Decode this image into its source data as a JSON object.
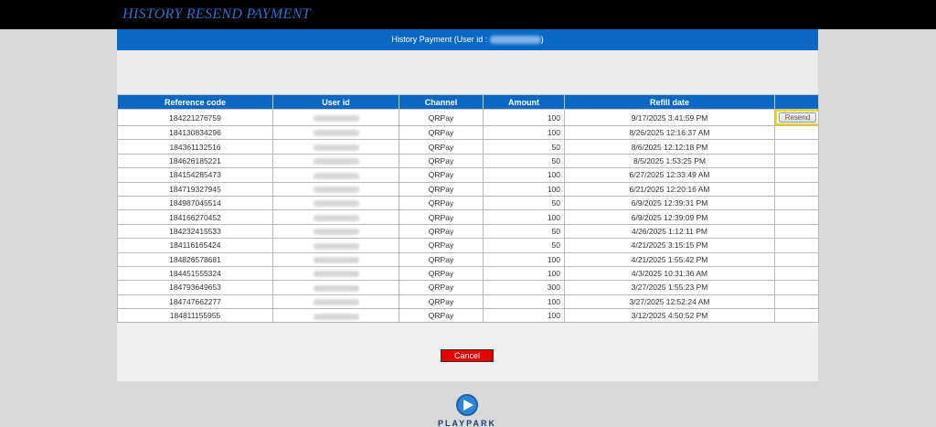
{
  "header": {
    "title": "HISTORY RESEND PAYMENT"
  },
  "panel": {
    "title_prefix": "History Payment (User id :",
    "title_suffix": ")"
  },
  "table": {
    "columns": [
      "Reference code",
      "User id",
      "Channel",
      "Amount",
      "Refill date",
      ""
    ],
    "rows": [
      {
        "ref": "184221276759",
        "channel": "QRPay",
        "amount": "100",
        "date": "9/17/2025 3:41:59 PM"
      },
      {
        "ref": "184130834296",
        "channel": "QRPay",
        "amount": "100",
        "date": "8/26/2025 12:16:37 AM"
      },
      {
        "ref": "184361132516",
        "channel": "QRPay",
        "amount": "50",
        "date": "8/6/2025 12:12:18 PM"
      },
      {
        "ref": "184626185221",
        "channel": "QRPay",
        "amount": "50",
        "date": "8/5/2025 1:53:25 PM"
      },
      {
        "ref": "184154285473",
        "channel": "QRPay",
        "amount": "100",
        "date": "6/27/2025 12:33:49 AM"
      },
      {
        "ref": "184719327945",
        "channel": "QRPay",
        "amount": "100",
        "date": "6/21/2025 12:20:16 AM"
      },
      {
        "ref": "184987045514",
        "channel": "QRPay",
        "amount": "50",
        "date": "6/9/2025 12:39:31 PM"
      },
      {
        "ref": "184166270452",
        "channel": "QRPay",
        "amount": "100",
        "date": "6/9/2025 12:39:09 PM"
      },
      {
        "ref": "184232415533",
        "channel": "QRPay",
        "amount": "50",
        "date": "4/26/2025 1:12:11 PM"
      },
      {
        "ref": "184116165424",
        "channel": "QRPay",
        "amount": "50",
        "date": "4/21/2025 3:15:15 PM"
      },
      {
        "ref": "184826578681",
        "channel": "QRPay",
        "amount": "100",
        "date": "4/21/2025 1:55:42 PM"
      },
      {
        "ref": "184451555324",
        "channel": "QRPay",
        "amount": "100",
        "date": "4/3/2025 10:31:36 AM"
      },
      {
        "ref": "184793649653",
        "channel": "QRPay",
        "amount": "300",
        "date": "3/27/2025 1:55:23 PM"
      },
      {
        "ref": "184747662277",
        "channel": "QRPay",
        "amount": "100",
        "date": "3/27/2025 12:52:24 AM"
      },
      {
        "ref": "184811155955",
        "channel": "QRPay",
        "amount": "100",
        "date": "3/12/2025 4:50:52 PM"
      }
    ],
    "resend_label": "Resend"
  },
  "actions": {
    "cancel_label": "Cancel"
  },
  "footer": {
    "logo_text": "PLAYPARK",
    "logo_icon": "play-icon"
  },
  "colors": {
    "accent": "#0868c4",
    "title": "#2a6fd6",
    "cancel": "#e60000",
    "highlight": "#f2d600"
  }
}
